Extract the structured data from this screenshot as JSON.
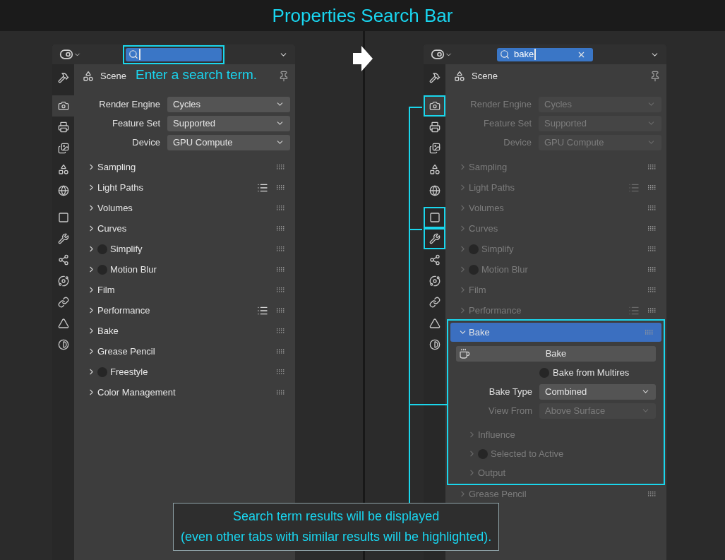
{
  "title": "Properties Search Bar",
  "panels": [
    {
      "search": {
        "active": true,
        "highlighted": true
      },
      "note": "Enter a search term.",
      "tabs": [
        {
          "kind": "tool",
          "selected": false,
          "highlighted": false
        },
        {
          "kind": "render",
          "selected": true,
          "highlighted": false
        },
        {
          "kind": "output",
          "selected": false,
          "highlighted": false
        },
        {
          "kind": "view_layer",
          "selected": false,
          "highlighted": false
        },
        {
          "kind": "scene",
          "selected": false,
          "highlighted": false
        },
        {
          "kind": "world",
          "selected": false,
          "highlighted": false
        },
        {
          "kind": "object",
          "selected": false,
          "highlighted": false
        },
        {
          "kind": "modifier",
          "selected": false,
          "highlighted": false
        },
        {
          "kind": "particles",
          "selected": false,
          "highlighted": false
        },
        {
          "kind": "physics",
          "selected": false,
          "highlighted": false
        },
        {
          "kind": "constraints",
          "selected": false,
          "highlighted": false
        },
        {
          "kind": "data",
          "selected": false,
          "highlighted": false
        },
        {
          "kind": "material",
          "selected": false,
          "highlighted": false
        }
      ],
      "header": {
        "title": "Scene"
      },
      "fields": [
        {
          "label": "Render Engine",
          "value": "Cycles",
          "dimmed": false
        },
        {
          "label": "Feature Set",
          "value": "Supported",
          "dimmed": false
        },
        {
          "label": "Device",
          "value": "GPU Compute",
          "dimmed": false
        }
      ],
      "sections": [
        {
          "label": "Sampling",
          "expanded": false,
          "matched": false,
          "dimmed": false,
          "presets": false
        },
        {
          "label": "Light Paths",
          "expanded": false,
          "matched": false,
          "dimmed": false,
          "presets": true
        },
        {
          "label": "Volumes",
          "expanded": false,
          "matched": false,
          "dimmed": false,
          "presets": false
        },
        {
          "label": "Curves",
          "expanded": false,
          "matched": false,
          "dimmed": false,
          "presets": false
        },
        {
          "label": "Simplify",
          "toggle": {
            "checked": false
          },
          "expanded": false,
          "matched": false,
          "dimmed": false,
          "presets": false
        },
        {
          "label": "Motion Blur",
          "toggle": {
            "checked": false
          },
          "expanded": false,
          "matched": false,
          "dimmed": false,
          "presets": false
        },
        {
          "label": "Film",
          "expanded": false,
          "matched": false,
          "dimmed": false,
          "presets": false
        },
        {
          "label": "Performance",
          "expanded": false,
          "matched": false,
          "dimmed": false,
          "presets": true
        },
        {
          "label": "Bake",
          "expanded": false,
          "matched": false,
          "dimmed": false,
          "presets": false
        },
        {
          "label": "Grease Pencil",
          "expanded": false,
          "matched": false,
          "dimmed": false,
          "presets": false
        },
        {
          "label": "Freestyle",
          "toggle": {
            "checked": false
          },
          "expanded": false,
          "matched": false,
          "dimmed": false,
          "presets": false
        },
        {
          "label": "Color Management",
          "expanded": false,
          "matched": false,
          "dimmed": false,
          "presets": false
        }
      ]
    },
    {
      "search": {
        "active": true,
        "highlighted": false,
        "value": "bake"
      },
      "tabs": [
        {
          "kind": "tool",
          "selected": false,
          "highlighted": false
        },
        {
          "kind": "render",
          "selected": true,
          "highlighted": true
        },
        {
          "kind": "output",
          "selected": false,
          "highlighted": false
        },
        {
          "kind": "view_layer",
          "selected": false,
          "highlighted": false
        },
        {
          "kind": "scene",
          "selected": false,
          "highlighted": false
        },
        {
          "kind": "world",
          "selected": false,
          "highlighted": false
        },
        {
          "kind": "object",
          "selected": false,
          "highlighted": true
        },
        {
          "kind": "modifier",
          "selected": false,
          "highlighted": true
        },
        {
          "kind": "particles",
          "selected": false,
          "highlighted": false
        },
        {
          "kind": "physics",
          "selected": false,
          "highlighted": false
        },
        {
          "kind": "constraints",
          "selected": false,
          "highlighted": false
        },
        {
          "kind": "data",
          "selected": false,
          "highlighted": false
        },
        {
          "kind": "material",
          "selected": false,
          "highlighted": false
        }
      ],
      "header": {
        "title": "Scene"
      },
      "fields": [
        {
          "label": "Render Engine",
          "value": "Cycles",
          "dimmed": true
        },
        {
          "label": "Feature Set",
          "value": "Supported",
          "dimmed": true
        },
        {
          "label": "Device",
          "value": "GPU Compute",
          "dimmed": true
        }
      ],
      "sections": [
        {
          "label": "Sampling",
          "expanded": false,
          "matched": false,
          "dimmed": true,
          "presets": false
        },
        {
          "label": "Light Paths",
          "expanded": false,
          "matched": false,
          "dimmed": true,
          "presets": true
        },
        {
          "label": "Volumes",
          "expanded": false,
          "matched": false,
          "dimmed": true,
          "presets": false
        },
        {
          "label": "Curves",
          "expanded": false,
          "matched": false,
          "dimmed": true,
          "presets": false
        },
        {
          "label": "Simplify",
          "toggle": {
            "checked": false
          },
          "expanded": false,
          "matched": false,
          "dimmed": true,
          "presets": false
        },
        {
          "label": "Motion Blur",
          "toggle": {
            "checked": false
          },
          "expanded": false,
          "matched": false,
          "dimmed": true,
          "presets": false
        },
        {
          "label": "Film",
          "expanded": false,
          "matched": false,
          "dimmed": true,
          "presets": false
        },
        {
          "label": "Performance",
          "expanded": false,
          "matched": false,
          "dimmed": true,
          "presets": true
        },
        {
          "label": "Bake",
          "expanded": true,
          "matched": true,
          "dimmed": false,
          "presets": false,
          "content": {
            "button": "Bake",
            "checkbox": {
              "label": "Bake from Multires",
              "checked": false
            },
            "fields": [
              {
                "label": "Bake Type",
                "value": "Combined",
                "dimmed": false
              },
              {
                "label": "View From",
                "value": "Above Surface",
                "dimmed": true
              }
            ],
            "subsections": [
              {
                "label": "Influence",
                "dimmed": true
              },
              {
                "label": "Selected to Active",
                "toggle": {
                  "checked": false
                },
                "dimmed": true
              },
              {
                "label": "Output",
                "dimmed": true
              }
            ]
          }
        },
        {
          "label": "Grease Pencil",
          "expanded": false,
          "matched": false,
          "dimmed": true,
          "presets": false
        }
      ]
    }
  ],
  "caption": [
    "Search term results will be displayed",
    "(even other tabs with similar results will be highlighted)."
  ]
}
